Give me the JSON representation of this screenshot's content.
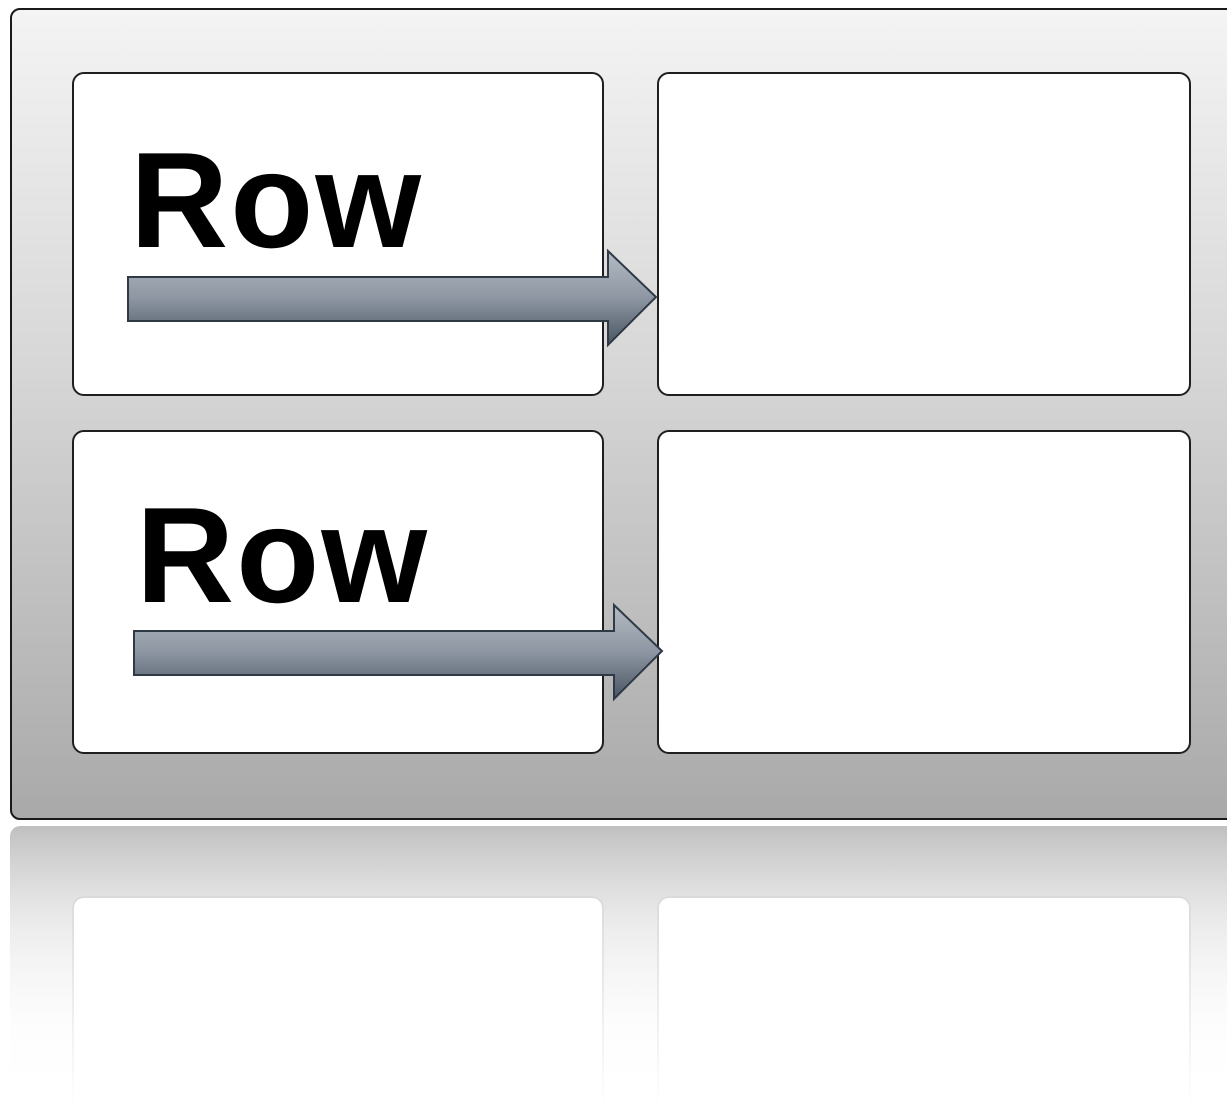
{
  "diagram": {
    "rows": [
      {
        "label": "Row"
      },
      {
        "label": "Row"
      }
    ],
    "colors": {
      "panel_top": "#f4f4f4",
      "panel_bottom": "#a9a9a9",
      "cell_fill": "#ffffff",
      "arrow_fill_light": "#aeb5bf",
      "arrow_fill_dark": "#4a5563",
      "arrow_stroke": "#2f3a46"
    },
    "icons": [
      "right-arrow-icon",
      "right-arrow-icon"
    ]
  }
}
